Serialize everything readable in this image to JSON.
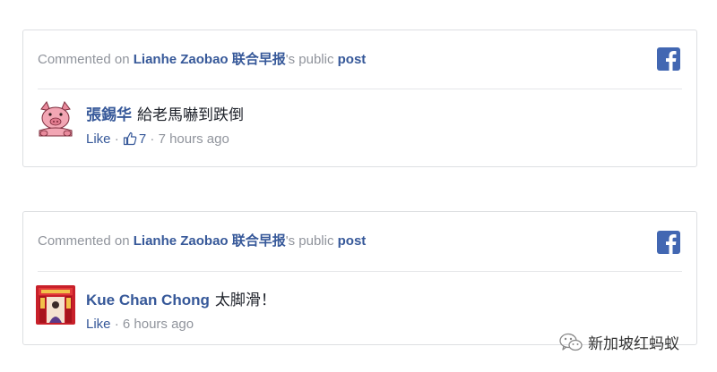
{
  "colors": {
    "link": "#365899",
    "muted": "#90949c",
    "facebook": "#4267b2",
    "border": "#dddfe2"
  },
  "cards": [
    {
      "header": {
        "prefix": "Commented on ",
        "page_name": "Lianhe Zaobao 联合早报",
        "middle": "'s public ",
        "post_link": "post"
      },
      "icon": "facebook-icon",
      "comment": {
        "avatar": "pig-avatar",
        "author": "張錫华",
        "text": "給老馬嚇到跌倒",
        "like_label": "Like",
        "sep1": " · ",
        "like_icon": "thumbs-up-icon",
        "like_count": "7",
        "sep2": " · ",
        "time": "7 hours ago"
      }
    },
    {
      "header": {
        "prefix": "Commented on ",
        "page_name": "Lianhe Zaobao 联合早报",
        "middle": "'s public ",
        "post_link": "post"
      },
      "icon": "facebook-icon",
      "comment": {
        "avatar": "photo-avatar",
        "author": "Kue Chan Chong",
        "text": "太脚滑！",
        "like_label": "Like",
        "sep1": " · ",
        "time": "6 hours ago"
      }
    }
  ],
  "watermark": {
    "icon": "wechat-icon",
    "text": "新加坡红蚂蚁"
  }
}
